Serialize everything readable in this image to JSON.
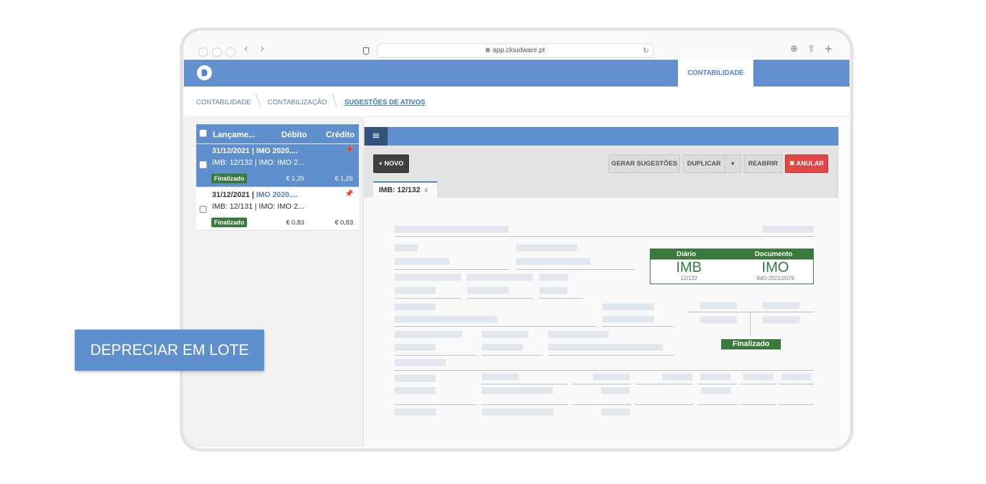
{
  "browser": {
    "url": "app.cloudware.pt"
  },
  "app": {
    "active_tab": "CONTABILIDADE"
  },
  "breadcrumbs": [
    "CONTABILIDADE",
    "CONTABILIZAÇÃO",
    "SUGESTÕES DE ATIVOS"
  ],
  "list": {
    "headers": {
      "entry": "Lançame...",
      "debit": "Débito",
      "credit": "Crédito"
    },
    "entries": [
      {
        "line1_date": "31/12/2021 | IMO 2020....",
        "line1_prefix": "",
        "line1_link": "",
        "line2": "IMB: 12/132 | IMO: IMO 2...",
        "status": "Finalizado",
        "debit": "€ 1,25",
        "credit": "€ 1,25",
        "selected": true
      },
      {
        "line1_date": "",
        "line1_prefix": "31/12/2021 | ",
        "line1_link": "IMO 2020....",
        "line2": "IMB: 12/131 | IMO: IMO 2...",
        "status": "Finalizado",
        "debit": "€ 0,83",
        "credit": "€ 0,83",
        "selected": false
      }
    ]
  },
  "toolbar": {
    "new_label": "+ NOVO",
    "generate_label": "GERAR SUGESTÕES",
    "duplicate_label": "DUPLICAR",
    "reopen_label": "REABRIR",
    "cancel_label": "✖ ANULAR"
  },
  "document_tab": {
    "label": "IMB: 12/132",
    "close": "x"
  },
  "info_box": {
    "journal_label": "Diário",
    "document_label": "Documento",
    "journal_code": "IMB",
    "journal_number": "12/132",
    "document_code": "IMO",
    "document_number": "IMO 2021/2076"
  },
  "document_status": "Finalizado",
  "cta_label": "DEPRECIAR EM LOTE",
  "colors": {
    "brand_blue": "#6290ce",
    "dark_blue": "#34527e",
    "success_green": "#3a7a3a",
    "danger_red": "#e04848"
  }
}
